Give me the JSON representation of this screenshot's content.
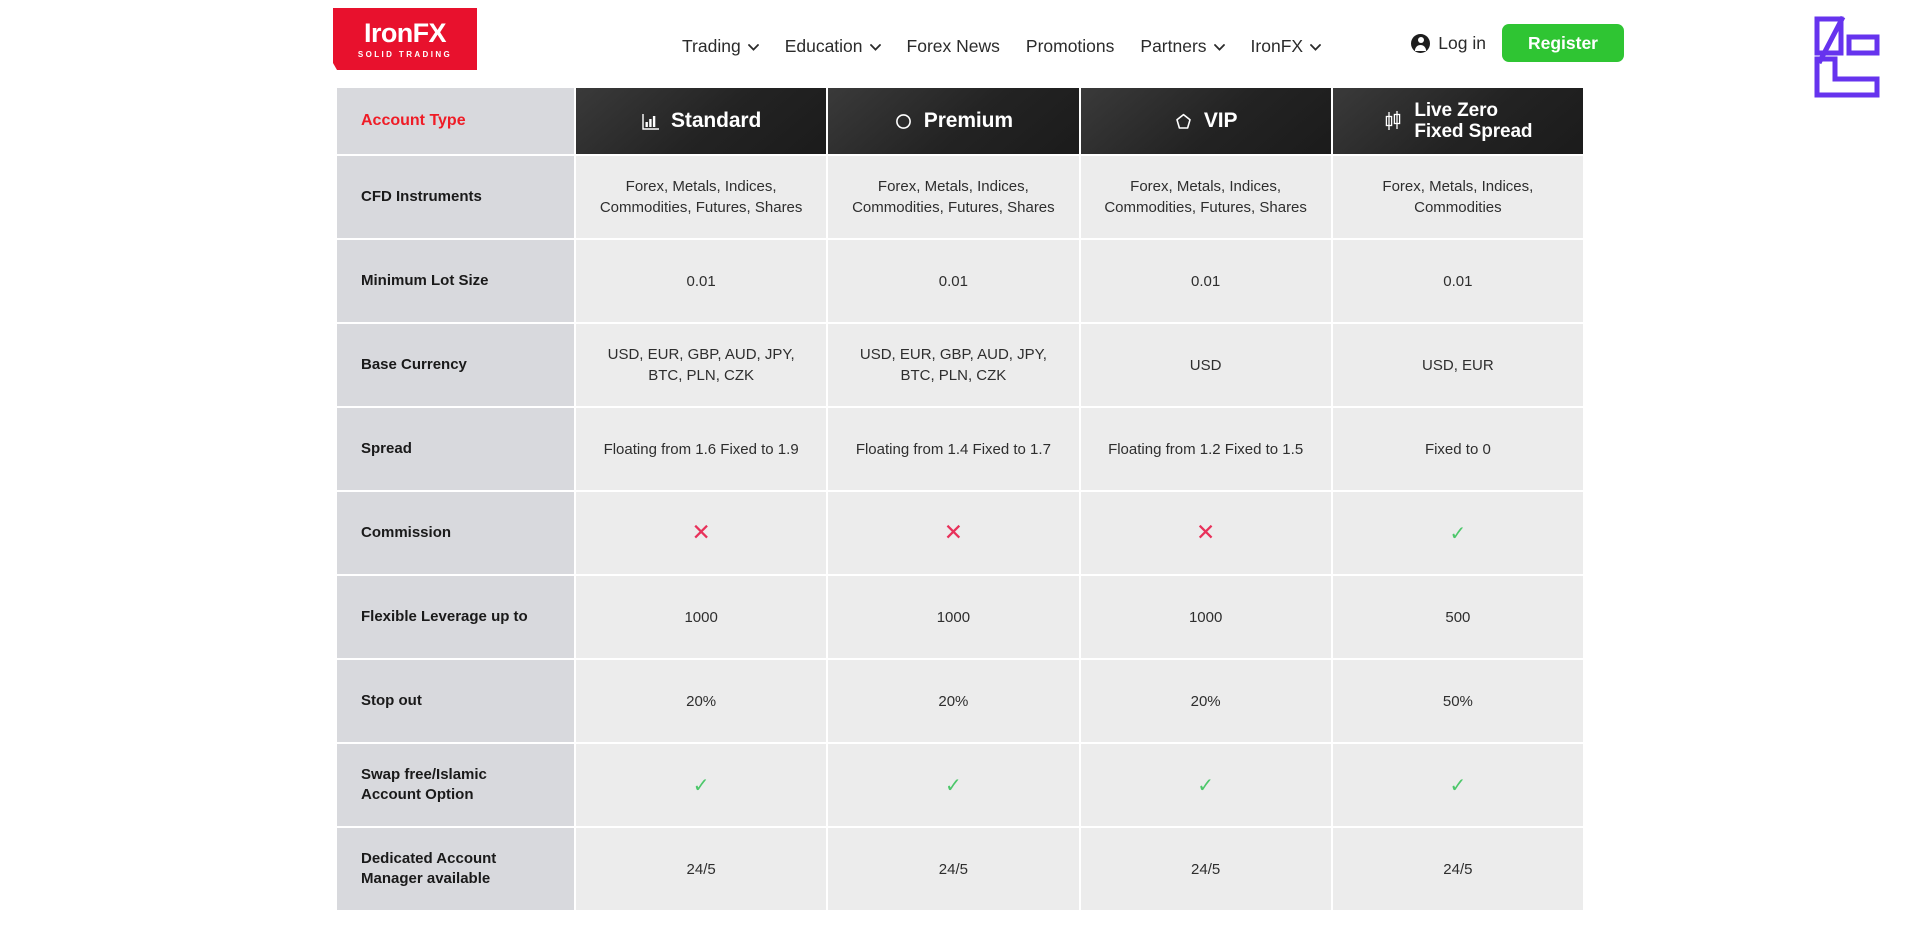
{
  "header": {
    "logo": {
      "main": "IronFX",
      "sub": "SOLID TRADING"
    },
    "nav": [
      {
        "label": "Trading",
        "has_dropdown": true,
        "icon": "chevron-down-icon"
      },
      {
        "label": "Education",
        "has_dropdown": true,
        "icon": "chevron-down-icon"
      },
      {
        "label": "Forex News",
        "has_dropdown": false
      },
      {
        "label": "Promotions",
        "has_dropdown": false
      },
      {
        "label": "Partners",
        "has_dropdown": true,
        "icon": "chevron-down-icon"
      },
      {
        "label": "IronFX",
        "has_dropdown": true,
        "icon": "chevron-down-icon"
      }
    ],
    "login_label": "Log in",
    "login_icon": "person-circle-icon",
    "register_label": "Register",
    "corner_logo_icon": "lc-monogram-logo",
    "colors": {
      "brand_red": "#e8112d",
      "register_green": "#2fc533",
      "corner_purple": "#6633ee",
      "account_type_red": "#ef1c26"
    }
  },
  "comparison_table": {
    "row_label_header": "Account Type",
    "columns": [
      {
        "name": "Standard",
        "icon": "bar-chart-icon",
        "two_line": false
      },
      {
        "name": "Premium",
        "icon": "circle-outline-icon",
        "two_line": false
      },
      {
        "name": "VIP",
        "icon": "pentagon-outline-icon",
        "two_line": false
      },
      {
        "name": "Live Zero\nFixed Spread",
        "line1": "Live Zero",
        "line2": "Fixed Spread",
        "icon": "candlestick-icon",
        "two_line": true
      }
    ],
    "rows": [
      {
        "label": "CFD Instruments",
        "values": [
          "Forex, Metals, Indices, Commodities, Futures, Shares",
          "Forex, Metals, Indices, Commodities, Futures, Shares",
          "Forex, Metals, Indices, Commodities, Futures, Shares",
          "Forex, Metals, Indices, Commodities"
        ]
      },
      {
        "label": "Minimum Lot Size",
        "values": [
          "0.01",
          "0.01",
          "0.01",
          "0.01"
        ]
      },
      {
        "label": "Base Currency",
        "values": [
          "USD, EUR, GBP, AUD, JPY, BTC, PLN, CZK",
          "USD, EUR, GBP, AUD, JPY, BTC, PLN, CZK",
          "USD",
          "USD, EUR"
        ]
      },
      {
        "label": "Spread",
        "values": [
          "Floating from 1.6 Fixed to 1.9",
          "Floating from 1.4 Fixed to 1.7",
          "Floating from 1.2 Fixed to 1.5",
          "Fixed to 0"
        ]
      },
      {
        "label": "Commission",
        "values": [
          "✕",
          "✕",
          "✕",
          "✓"
        ],
        "value_kinds": [
          "cross",
          "cross",
          "cross",
          "check"
        ]
      },
      {
        "label": "Flexible Leverage up to",
        "values": [
          "1000",
          "1000",
          "1000",
          "500"
        ]
      },
      {
        "label": "Stop out",
        "values": [
          "20%",
          "20%",
          "20%",
          "50%"
        ]
      },
      {
        "label": "Swap free/Islamic Account Option",
        "values": [
          "✓",
          "✓",
          "✓",
          "✓"
        ],
        "value_kinds": [
          "check",
          "check",
          "check",
          "check"
        ]
      },
      {
        "label": "Dedicated Account Manager available",
        "values": [
          "24/5",
          "24/5",
          "24/5",
          "24/5"
        ]
      }
    ],
    "colors": {
      "label_cell_bg": "#d8d9dd",
      "value_cell_bg": "#ececec",
      "header_cell_bg": "#232323",
      "cross_color": "#e8315a",
      "check_color": "#4cc76a"
    }
  }
}
